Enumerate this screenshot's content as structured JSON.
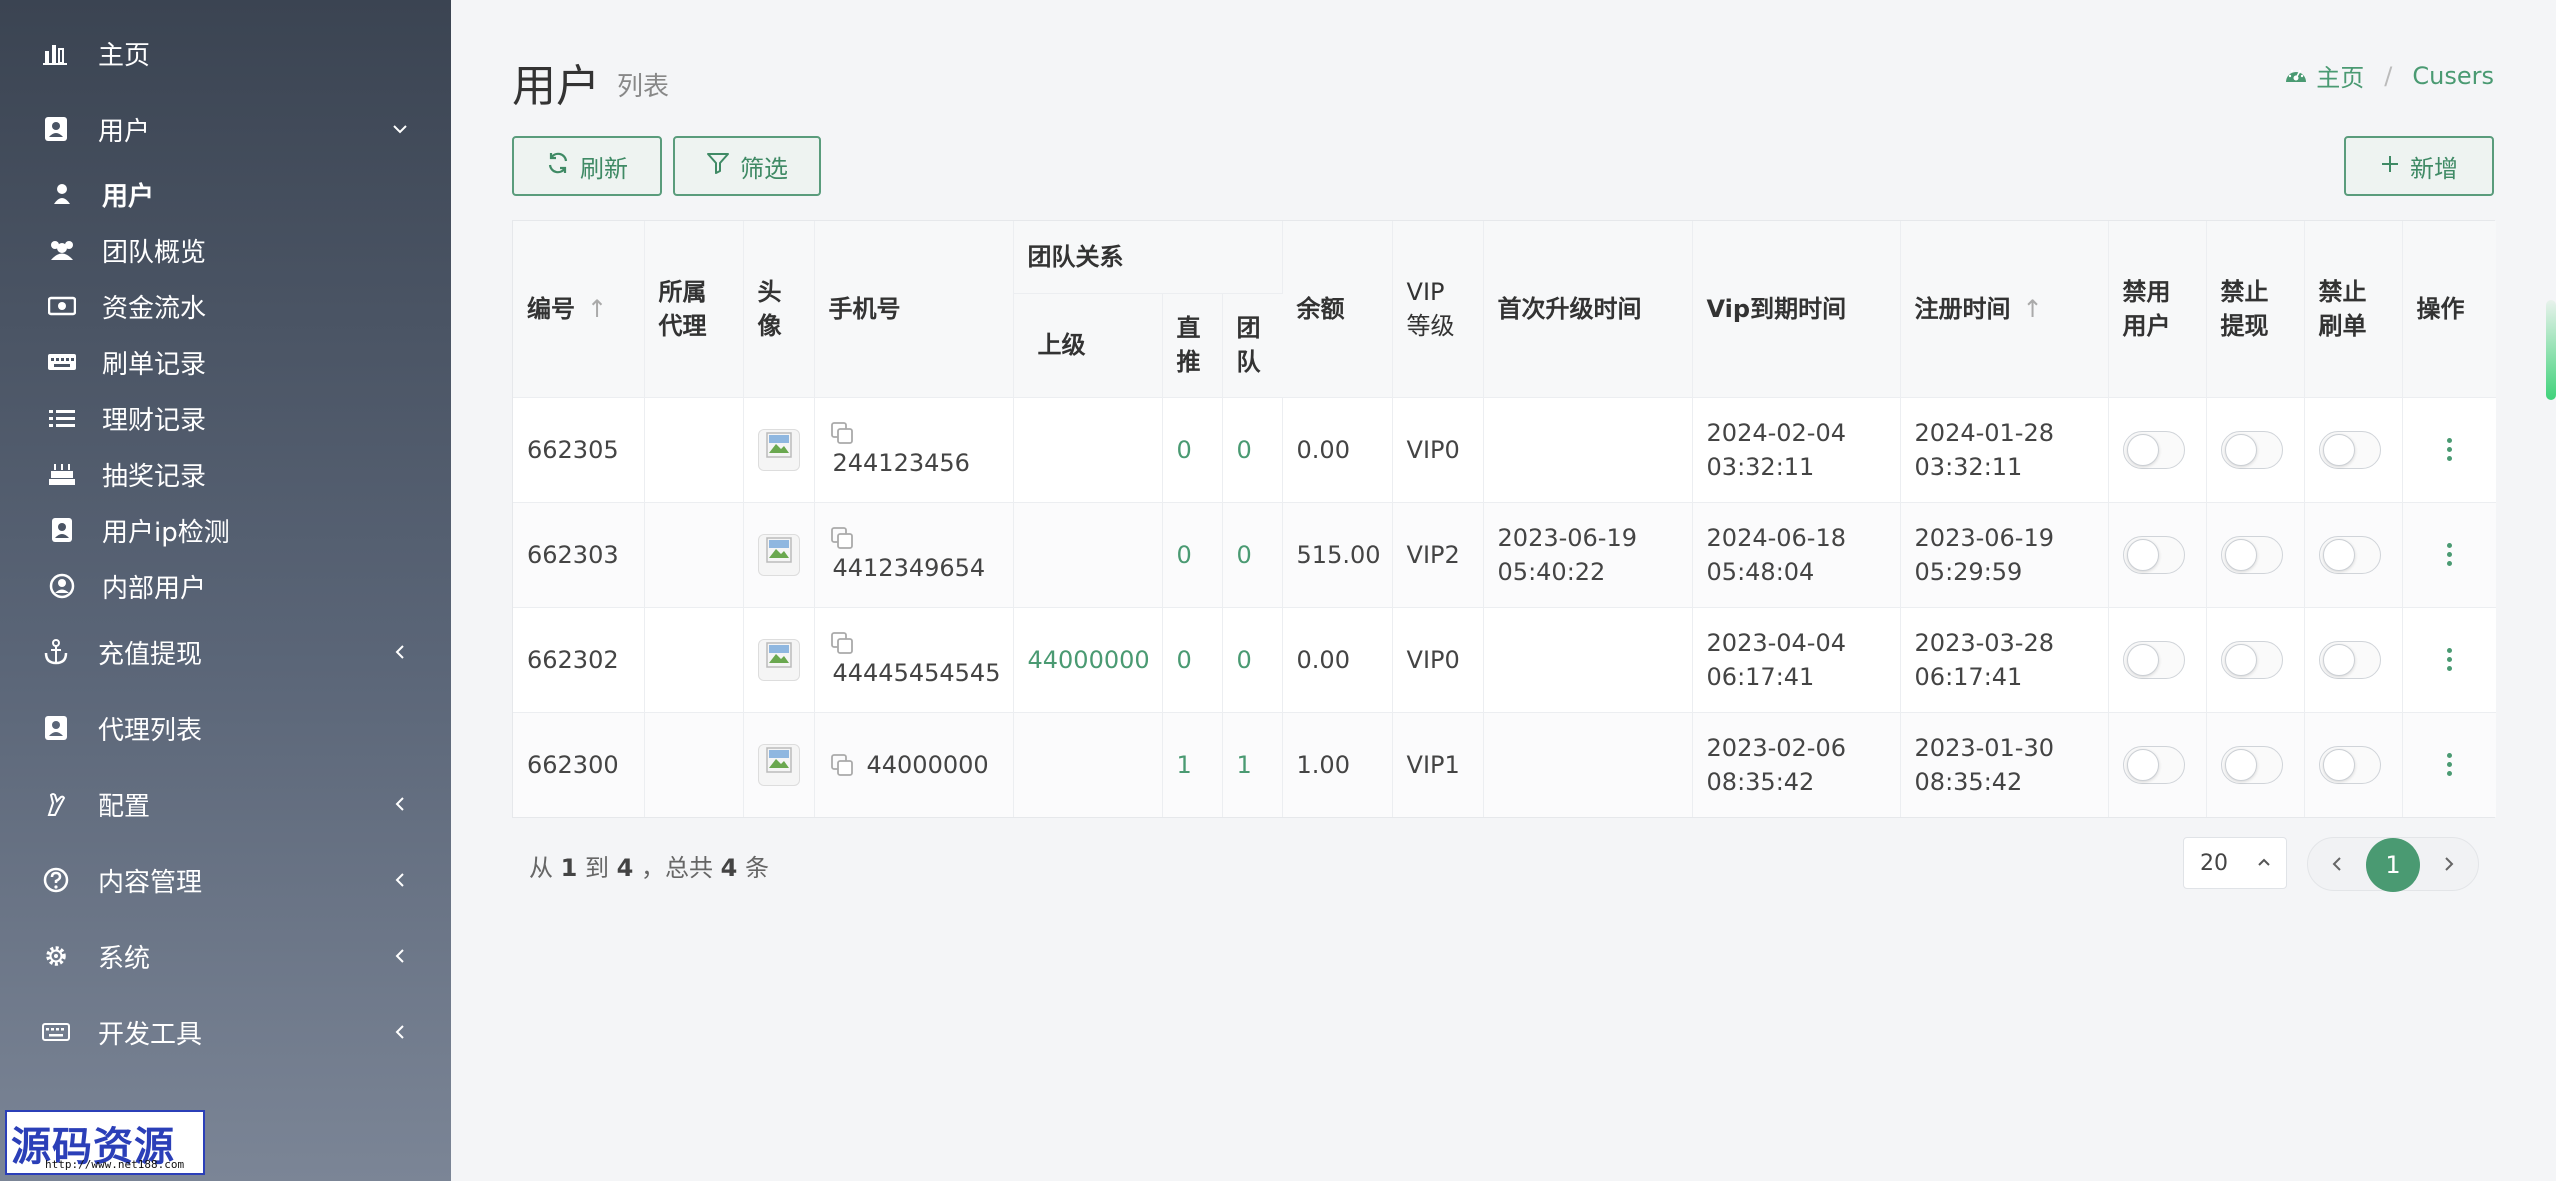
{
  "sidebar": {
    "items": [
      {
        "label": "主页",
        "icon": "bar-chart-icon"
      },
      {
        "label": "用户",
        "icon": "user-card-icon",
        "expanded": true,
        "children": [
          {
            "label": "用户",
            "icon": "user-icon",
            "active": true
          },
          {
            "label": "团队概览",
            "icon": "users-icon"
          },
          {
            "label": "资金流水",
            "icon": "money-icon"
          },
          {
            "label": "刷单记录",
            "icon": "keyboard-icon"
          },
          {
            "label": "理财记录",
            "icon": "list-icon"
          },
          {
            "label": "抽奖记录",
            "icon": "cake-icon"
          },
          {
            "label": "用户ip检测",
            "icon": "id-badge-icon"
          },
          {
            "label": "内部用户",
            "icon": "user-circle-icon"
          }
        ]
      },
      {
        "label": "充值提现",
        "icon": "anchor-icon"
      },
      {
        "label": "代理列表",
        "icon": "user-card-icon"
      },
      {
        "label": "配置",
        "icon": "hand-icon"
      },
      {
        "label": "内容管理",
        "icon": "question-icon"
      },
      {
        "label": "系统",
        "icon": "gear-icon"
      },
      {
        "label": "开发工具",
        "icon": "keyboard-icon"
      }
    ],
    "logo": {
      "text": "源码资源网",
      "url_text": "http://www.net188.com"
    }
  },
  "header": {
    "title": "用户",
    "subtitle": "列表",
    "breadcrumb": {
      "home": "主页",
      "current": "Cusers"
    }
  },
  "toolbar": {
    "refresh_label": "刷新",
    "filter_label": "筛选",
    "add_label": "新增"
  },
  "table": {
    "columns": {
      "id": "编号",
      "agent": "所属代理",
      "avatar": "头像",
      "phone": "手机号",
      "team": "团队关系",
      "parent": "上级",
      "direct": "直推",
      "team_count": "团队",
      "balance": "余额",
      "vip": "VIP 等级",
      "first_upgrade": "首次升级时间",
      "vip_expire": "Vip到期时间",
      "register": "注册时间",
      "disable_user": "禁用用户",
      "disable_withdraw": "禁止提现",
      "disable_order": "禁止刷单",
      "action": "操作"
    },
    "rows": [
      {
        "id": "662305",
        "agent": "",
        "phone": "244123456",
        "parent": "",
        "direct": "0",
        "team": "0",
        "balance": "0.00",
        "vip": "VIP0",
        "first_upgrade": "",
        "vip_expire_date": "2024-02-04",
        "vip_expire_time": "03:32:11",
        "register_date": "2024-01-28",
        "register_time": "03:32:11"
      },
      {
        "id": "662303",
        "agent": "",
        "phone": "4412349654",
        "parent": "",
        "direct": "0",
        "team": "0",
        "balance": "515.00",
        "vip": "VIP2",
        "first_upgrade_date": "2023-06-19",
        "first_upgrade_time": "05:40:22",
        "vip_expire_date": "2024-06-18",
        "vip_expire_time": "05:48:04",
        "register_date": "2023-06-19",
        "register_time": "05:29:59"
      },
      {
        "id": "662302",
        "agent": "",
        "phone": "44445454545",
        "parent": "44000000",
        "direct": "0",
        "team": "0",
        "balance": "0.00",
        "vip": "VIP0",
        "first_upgrade": "",
        "vip_expire_date": "2023-04-04",
        "vip_expire_time": "06:17:41",
        "register_date": "2023-03-28",
        "register_time": "06:17:41"
      },
      {
        "id": "662300",
        "agent": "",
        "phone": "44000000",
        "parent": "",
        "direct": "1",
        "team": "1",
        "balance": "1.00",
        "vip": "VIP1",
        "first_upgrade": "",
        "vip_expire_date": "2023-02-06",
        "vip_expire_time": "08:35:42",
        "register_date": "2023-01-30",
        "register_time": "08:35:42"
      }
    ]
  },
  "pagination": {
    "from_prefix": "从",
    "from": "1",
    "to_word": "到",
    "to": "4",
    "total_prefix": "，总共",
    "total": "4",
    "unit": "条",
    "page_size": "20",
    "current_page": "1"
  },
  "colors": {
    "accent": "#4a9a72",
    "sidebar_top": "#3b4452",
    "sidebar_bottom": "#7b8596"
  }
}
